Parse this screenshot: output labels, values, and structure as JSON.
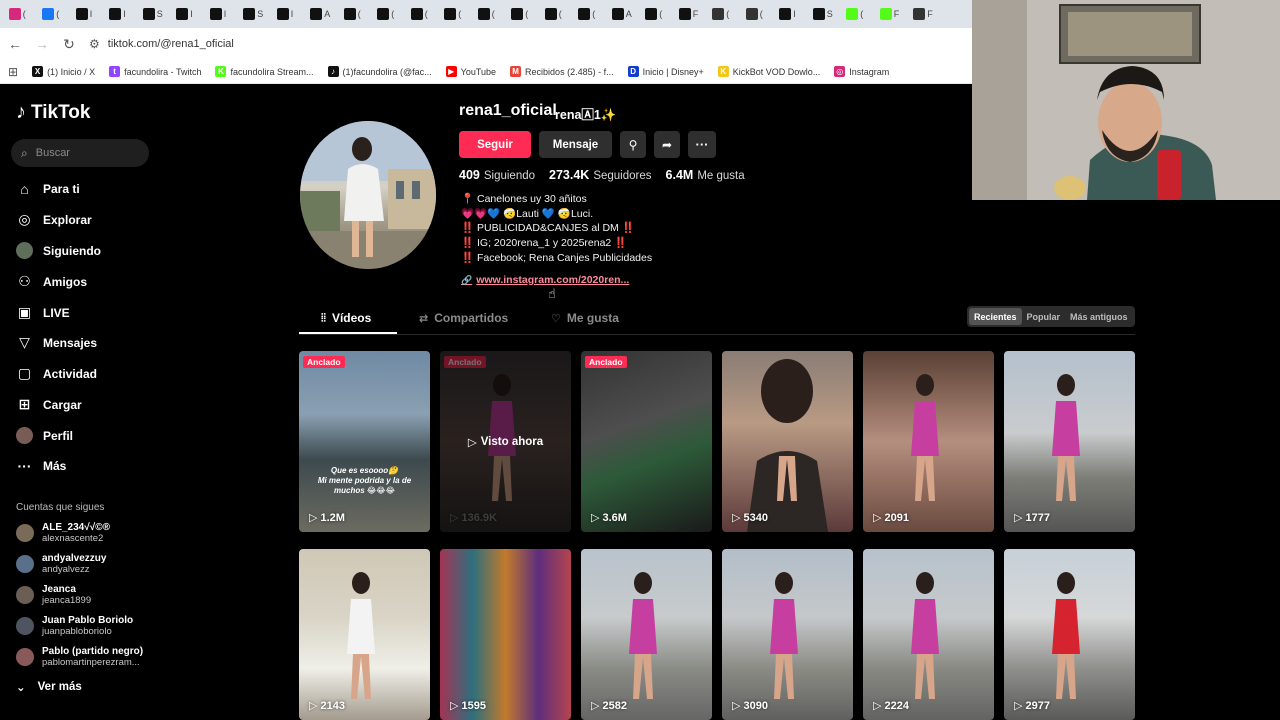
{
  "browser": {
    "tabs": [
      {
        "icon": "instagram-icon",
        "color": "#d6297b",
        "text": "("
      },
      {
        "icon": "facebook-icon",
        "color": "#1877f2",
        "text": "("
      },
      {
        "icon": "x-icon",
        "color": "#111111",
        "text": "I"
      },
      {
        "icon": "x-icon",
        "color": "#111111",
        "text": "I"
      },
      {
        "icon": "x-icon",
        "color": "#111111",
        "text": "S"
      },
      {
        "icon": "x-icon",
        "color": "#111111",
        "text": "I"
      },
      {
        "icon": "x-icon",
        "color": "#111111",
        "text": "I"
      },
      {
        "icon": "x-icon",
        "color": "#111111",
        "text": "S"
      },
      {
        "icon": "x-icon",
        "color": "#111111",
        "text": "I"
      },
      {
        "icon": "tiktok-icon",
        "color": "#111111",
        "text": "A"
      },
      {
        "icon": "tiktok-icon",
        "color": "#111111",
        "text": "("
      },
      {
        "icon": "tiktok-icon",
        "color": "#111111",
        "text": "("
      },
      {
        "icon": "tiktok-icon",
        "color": "#111111",
        "text": "("
      },
      {
        "icon": "tiktok-icon",
        "color": "#111111",
        "text": "("
      },
      {
        "icon": "tiktok-icon",
        "color": "#111111",
        "text": "("
      },
      {
        "icon": "tiktok-icon",
        "color": "#111111",
        "text": "("
      },
      {
        "icon": "tiktok-icon",
        "color": "#111111",
        "text": "("
      },
      {
        "icon": "tiktok-icon",
        "color": "#111111",
        "text": "("
      },
      {
        "icon": "tiktok-icon",
        "color": "#111111",
        "text": "A"
      },
      {
        "icon": "tiktok-icon",
        "color": "#111111",
        "text": "("
      },
      {
        "icon": "tiktok-icon",
        "color": "#111111",
        "text": "F"
      },
      {
        "icon": "github-icon",
        "color": "#333333",
        "text": "("
      },
      {
        "icon": "github-icon",
        "color": "#333333",
        "text": "("
      },
      {
        "icon": "tiktok-icon",
        "color": "#111111",
        "text": "I"
      },
      {
        "icon": "x-icon",
        "color": "#111111",
        "text": "S"
      },
      {
        "icon": "kick-icon",
        "color": "#53fc18",
        "text": "("
      },
      {
        "icon": "kick-icon",
        "color": "#53fc18",
        "text": "F"
      },
      {
        "icon": "github-icon",
        "color": "#333333",
        "text": "F"
      }
    ],
    "url": "tiktok.com/@rena1_oficial",
    "bookmarks": [
      {
        "icon": "x-icon",
        "color": "#111111",
        "glyph": "X",
        "label": "(1) Inicio / X"
      },
      {
        "icon": "twitch-icon",
        "color": "#9146ff",
        "glyph": "t",
        "label": "facundolira - Twitch"
      },
      {
        "icon": "kick-icon",
        "color": "#53fc18",
        "glyph": "K",
        "label": "facundolira Stream..."
      },
      {
        "icon": "tiktok-icon",
        "color": "#111111",
        "glyph": "♪",
        "label": "(1)facundolira (@fac..."
      },
      {
        "icon": "youtube-icon",
        "color": "#ff0000",
        "glyph": "▶",
        "label": "YouTube"
      },
      {
        "icon": "gmail-icon",
        "color": "#ea4335",
        "glyph": "M",
        "label": "Recibidos (2.485) - f..."
      },
      {
        "icon": "disney-icon",
        "color": "#113ccf",
        "glyph": "D",
        "label": "Inicio | Disney+"
      },
      {
        "icon": "kickbot-icon",
        "color": "#f5c518",
        "glyph": "K",
        "label": "KickBot VOD Dowlo..."
      },
      {
        "icon": "instagram-icon",
        "color": "#d6297b",
        "glyph": "◎",
        "label": "Instagram"
      }
    ]
  },
  "app": {
    "logo": "TikTok",
    "search_placeholder": "Buscar",
    "nav": [
      {
        "icon": "home-icon",
        "glyph": "⌂",
        "label": "Para ti"
      },
      {
        "icon": "compass-icon",
        "glyph": "◎",
        "label": "Explorar"
      },
      {
        "icon": "avatar-icon",
        "glyph": "",
        "label": "Siguiendo"
      },
      {
        "icon": "friends-icon",
        "glyph": "⚇",
        "label": "Amigos"
      },
      {
        "icon": "live-icon",
        "glyph": "▣",
        "label": "LIVE"
      },
      {
        "icon": "messages-icon",
        "glyph": "▽",
        "label": "Mensajes"
      },
      {
        "icon": "activity-icon",
        "glyph": "▢",
        "label": "Actividad",
        "badge": "2"
      },
      {
        "icon": "upload-icon",
        "glyph": "⊞",
        "label": "Cargar"
      },
      {
        "icon": "profile-icon",
        "glyph": "",
        "label": "Perfil"
      },
      {
        "icon": "more-icon",
        "glyph": "···",
        "label": "Más"
      }
    ],
    "following_heading": "Cuentas que sigues",
    "following": [
      {
        "name": "ALE_234√√©®",
        "handle": "alexnascente2",
        "color": "#7a6a58"
      },
      {
        "name": "andyalvezzuy",
        "handle": "andyalvezz",
        "color": "#5a6f8a"
      },
      {
        "name": "Jeanca",
        "handle": "jeanca1899",
        "color": "#6b5f55"
      },
      {
        "name": "Juan Pablo Boriolo",
        "handle": "juanpabloboriolo",
        "color": "#4e5560"
      },
      {
        "name": "Pablo (partido negro)",
        "handle": "pablomartinperezram...",
        "color": "#8a5a5a"
      }
    ],
    "see_more": "Ver más"
  },
  "profile": {
    "username": "rena1_oficial",
    "nickname": "rena🄰1✨",
    "follow_button": "Seguir",
    "message_button": "Mensaje",
    "stats": [
      {
        "value": "409",
        "label": "Siguiendo"
      },
      {
        "value": "273.4K",
        "label": "Seguidores"
      },
      {
        "value": "6.4M",
        "label": "Me gusta"
      }
    ],
    "bio": [
      "📍 Canelones uy 30 añitos",
      "💗💗💙 🤕Lauti 💙 🤕Luci.",
      "‼️ PUBLICIDAD&CANJES al DM ‼️",
      "‼️ IG; 2020rena_1 y 2025rena2 ‼️",
      "‼️ Facebook; Rena Canjes Publicidades"
    ],
    "link": "www.instagram.com/2020ren...",
    "accent": "#fe2c55"
  },
  "tabs": {
    "items": [
      "Vídeos",
      "Compartidos",
      "Me gusta"
    ],
    "sort": [
      "Recientes",
      "Popular",
      "Más antiguos"
    ]
  },
  "videos": [
    {
      "views": "1.2M",
      "pinned": "Anclado",
      "caption": "Que es esoooo🤔\nMi mente podrida y la de muchos 😂😂😂",
      "seen": ""
    },
    {
      "views": "136.9K",
      "pinned": "Anclado",
      "caption": "",
      "seen": "Visto ahora"
    },
    {
      "views": "3.6M",
      "pinned": "Anclado",
      "caption": "",
      "seen": ""
    },
    {
      "views": "5340",
      "pinned": "",
      "caption": "",
      "seen": ""
    },
    {
      "views": "2091",
      "pinned": "",
      "caption": "",
      "seen": ""
    },
    {
      "views": "1777",
      "pinned": "",
      "caption": "",
      "seen": ""
    },
    {
      "views": "2143",
      "pinned": "",
      "caption": "",
      "seen": ""
    },
    {
      "views": "1595",
      "pinned": "",
      "caption": "",
      "seen": ""
    },
    {
      "views": "2582",
      "pinned": "",
      "caption": "",
      "seen": ""
    },
    {
      "views": "3090",
      "pinned": "",
      "caption": "",
      "seen": ""
    },
    {
      "views": "2224",
      "pinned": "",
      "caption": "",
      "seen": ""
    },
    {
      "views": "2977",
      "pinned": "",
      "caption": "",
      "seen": ""
    }
  ]
}
